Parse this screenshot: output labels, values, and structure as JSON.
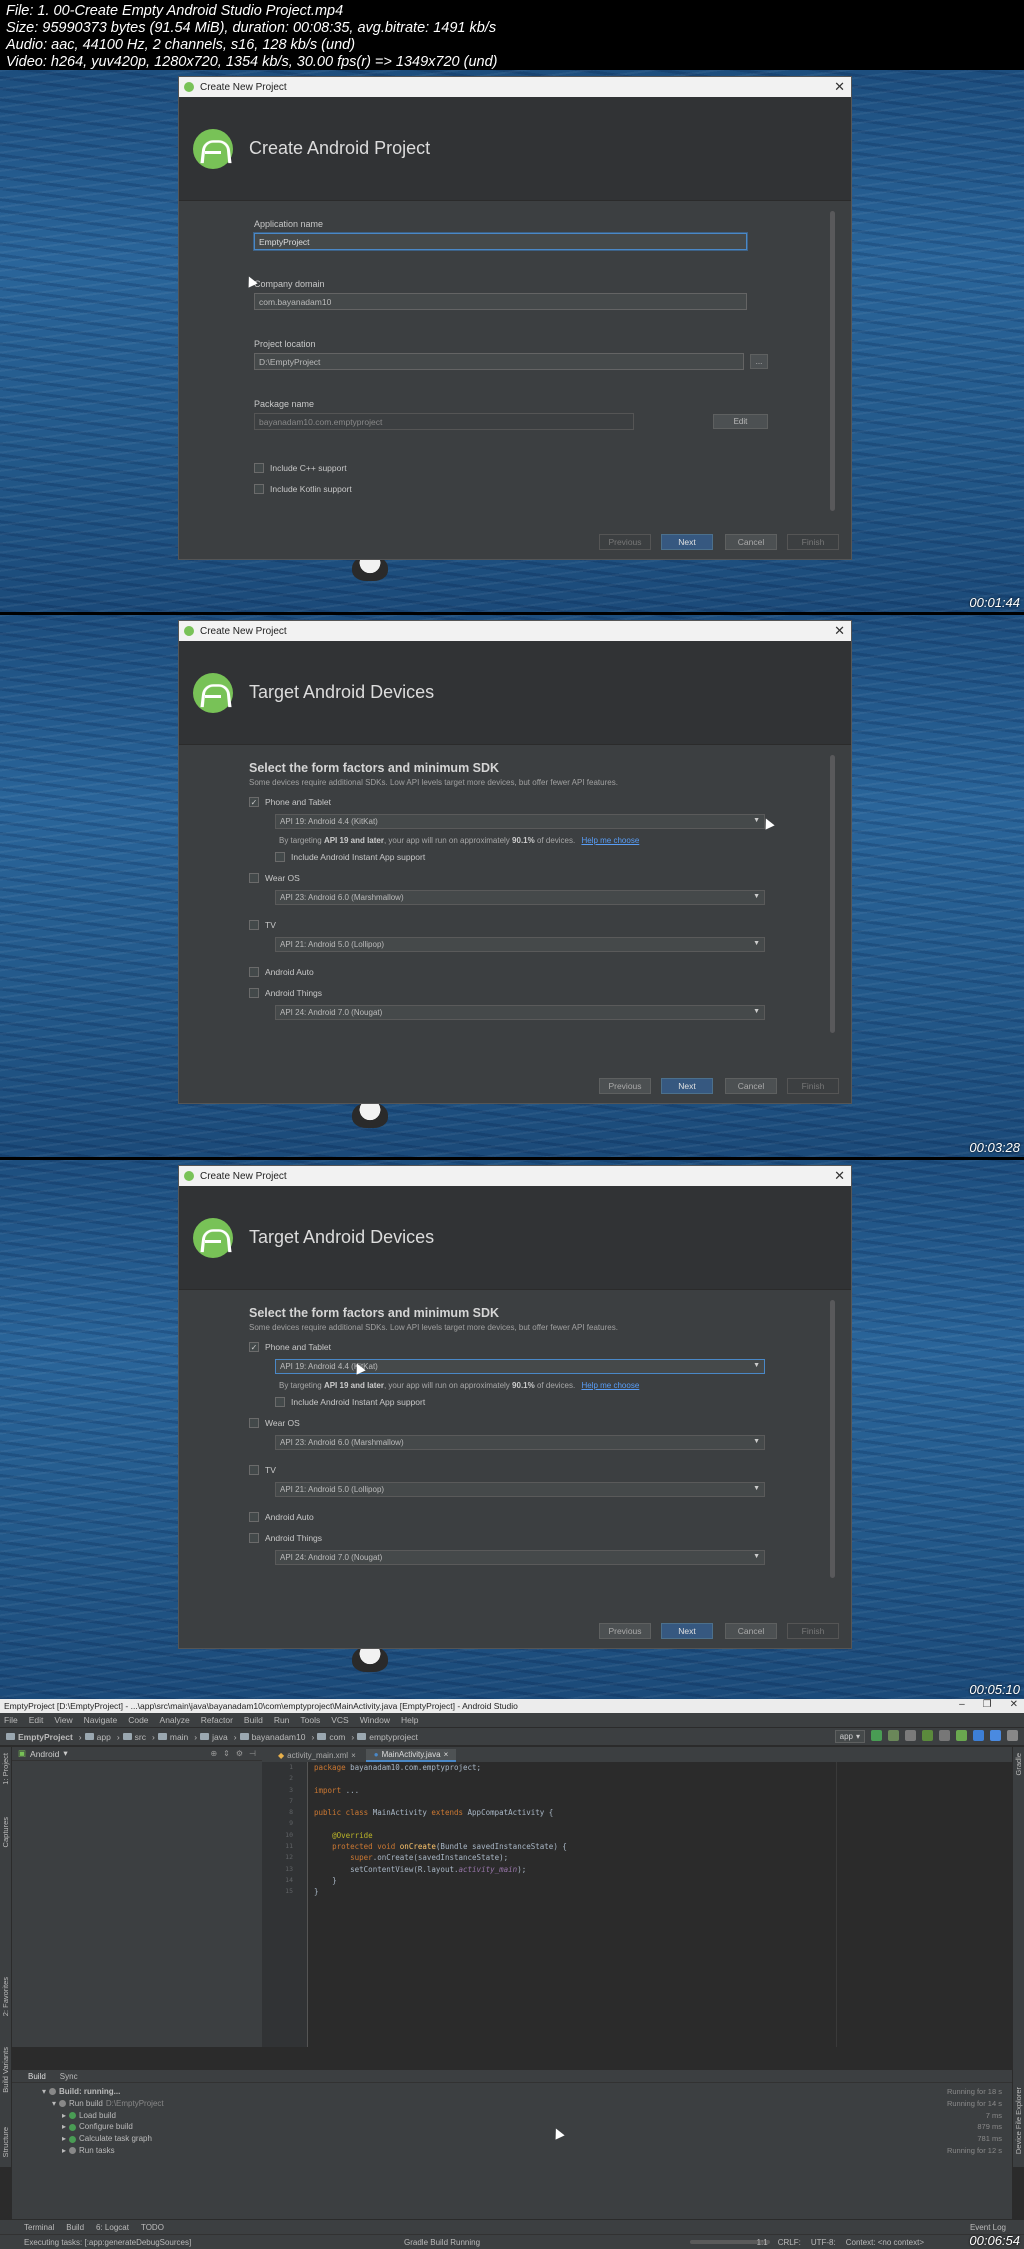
{
  "file_info": {
    "line1": "File: 1. 00-Create Empty Android Studio Project.mp4",
    "line2": "Size: 95990373 bytes (91.54 MiB), duration: 00:08:35, avg.bitrate: 1491 kb/s",
    "line3": "Audio: aac, 44100 Hz, 2 channels, s16, 128 kb/s (und)",
    "line4": "Video: h264, yuv420p, 1280x720, 1354 kb/s, 30.00 fps(r) => 1349x720 (und)"
  },
  "frame1": {
    "timestamp": "00:01:44",
    "window_title": "Create New Project",
    "header": "Create Android Project",
    "app_name_label": "Application name",
    "app_name_value": "EmptyProject",
    "company_label": "Company domain",
    "company_value": "com.bayanadam10",
    "location_label": "Project location",
    "location_value": "D:\\EmptyProject",
    "browse_label": "...",
    "package_label": "Package name",
    "package_value": "bayanadam10.com.emptyproject",
    "edit_label": "Edit",
    "cpp_label": "Include C++ support",
    "kotlin_label": "Include Kotlin support",
    "btn_previous": "Previous",
    "btn_next": "Next",
    "btn_cancel": "Cancel",
    "btn_finish": "Finish"
  },
  "frame2": {
    "timestamp": "00:03:28",
    "window_title": "Create New Project",
    "header": "Target Android Devices",
    "title": "Select the form factors and minimum SDK",
    "subtitle": "Some devices require additional SDKs. Low API levels target more devices, but offer fewer API features.",
    "phone_label": "Phone and Tablet",
    "phone_api": "API 19: Android 4.4 (KitKat)",
    "note_prefix": "By targeting",
    "note_api": "API 19 and later",
    "note_mid": ", your app will run on approximately",
    "note_pct": "90.1%",
    "note_suffix": "of devices.",
    "help_link": "Help me choose",
    "instant_label": "Include Android Instant App support",
    "wear_label": "Wear OS",
    "wear_api": "API 23: Android 6.0 (Marshmallow)",
    "tv_label": "TV",
    "tv_api": "API 21: Android 5.0 (Lollipop)",
    "auto_label": "Android Auto",
    "things_label": "Android Things",
    "things_api": "API 24: Android 7.0 (Nougat)",
    "btn_previous": "Previous",
    "btn_next": "Next",
    "btn_cancel": "Cancel",
    "btn_finish": "Finish"
  },
  "frame3": {
    "timestamp": "00:05:10",
    "window_title": "Create New Project",
    "header": "Target Android Devices",
    "title": "Select the form factors and minimum SDK",
    "subtitle": "Some devices require additional SDKs. Low API levels target more devices, but offer fewer API features.",
    "phone_label": "Phone and Tablet",
    "phone_api": "API 19: Android 4.4 (KitKat)",
    "note_prefix": "By targeting",
    "note_api": "API 19 and later",
    "note_mid": ", your app will run on approximately",
    "note_pct": "90.1%",
    "note_suffix": "of devices.",
    "help_link": "Help me choose",
    "instant_label": "Include Android Instant App support",
    "wear_label": "Wear OS",
    "wear_api": "API 23: Android 6.0 (Marshmallow)",
    "tv_label": "TV",
    "tv_api": "API 21: Android 5.0 (Lollipop)",
    "auto_label": "Android Auto",
    "things_label": "Android Things",
    "things_api": "API 24: Android 7.0 (Nougat)",
    "btn_previous": "Previous",
    "btn_next": "Next",
    "btn_cancel": "Cancel",
    "btn_finish": "Finish"
  },
  "frame4": {
    "timestamp": "00:06:54",
    "window_title": "EmptyProject [D:\\EmptyProject] - ...\\app\\src\\main\\java\\bayanadam10\\com\\emptyproject\\MainActivity.java [EmptyProject] - Android Studio",
    "menu": [
      "File",
      "Edit",
      "View",
      "Navigate",
      "Code",
      "Analyze",
      "Refactor",
      "Build",
      "Run",
      "Tools",
      "VCS",
      "Window",
      "Help"
    ],
    "breadcrumbs": [
      "EmptyProject",
      "app",
      "src",
      "main",
      "java",
      "bayanadam10",
      "com",
      "emptyproject"
    ],
    "run_config": "app",
    "project_view": "Android",
    "tabs": [
      "activity_main.xml",
      "MainActivity.java"
    ],
    "code": {
      "l1_kw": "package",
      "l1_rest": " bayanadam10.com.emptyproject;",
      "l3_kw": "import",
      "l3_rest": " ...",
      "l5_kw": "public class",
      "l5_rest": " MainActivity ",
      "l5_kw2": "extends",
      "l5_rest2": " AppCompatActivity {",
      "l7": "@Override",
      "l8_kw": "protected void",
      "l8_fn": " onCreate",
      "l8_rest": "(Bundle savedInstanceState) {",
      "l9_kw": "super",
      "l9_rest": ".onCreate(savedInstanceState);",
      "l10_a": "setContentView(R.layout.",
      "l10_b": "activity_main",
      "l10_c": ");",
      "l11": "}",
      "l12": "}"
    },
    "line_numbers": [
      "1",
      "2",
      "3",
      "7",
      "8",
      "9",
      "10",
      "11",
      "12",
      "13",
      "14",
      "15"
    ],
    "build_tabs": [
      "Build",
      "Sync"
    ],
    "build_tree": {
      "root": "Build: running...",
      "run_build": "Run build",
      "run_build_path": "D:\\EmptyProject",
      "load": "Load build",
      "configure": "Configure build",
      "calc": "Calculate task graph",
      "run_tasks": "Run tasks"
    },
    "build_times": [
      "Running for 18 s",
      "Running for 14 s",
      "7 ms",
      "879 ms",
      "781 ms",
      "Running for 12 s"
    ],
    "tool_tabs": [
      "Terminal",
      "Build",
      "6: Logcat",
      "TODO"
    ],
    "event_log": "Event Log",
    "status_left": "Executing tasks: [:app:generateDebugSources]",
    "status_mid": "Gradle Build Running",
    "status_right": [
      "1:1",
      "CRLF:",
      "UTF-8:",
      "Context: <no context>"
    ]
  }
}
